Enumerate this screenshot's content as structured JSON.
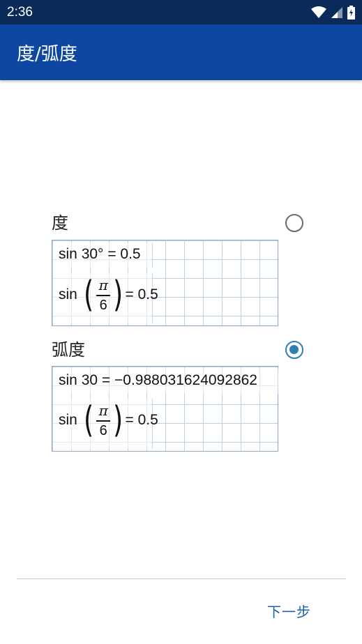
{
  "status_bar": {
    "time": "2:36"
  },
  "app_bar": {
    "title": "度/弧度"
  },
  "options": [
    {
      "label": "度",
      "selected": false,
      "example1": {
        "func": "sin",
        "arg": "30°",
        "equals": "=",
        "result": "0.5"
      },
      "example2": {
        "func": "sin",
        "numerator": "π",
        "denominator": "6",
        "equals": "=",
        "result": "0.5"
      }
    },
    {
      "label": "弧度",
      "selected": true,
      "example1": {
        "func": "sin",
        "arg": "30",
        "equals": "=",
        "result": "−0.988031624092862"
      },
      "example2": {
        "func": "sin",
        "numerator": "π",
        "denominator": "6",
        "equals": "=",
        "result": "0.5"
      }
    }
  ],
  "footer": {
    "next_label": "下一步"
  },
  "colors": {
    "status_bar": "#0b2a5a",
    "app_bar": "#0d47a1",
    "accent": "#2f7fb3",
    "link": "#1d5fa8"
  }
}
